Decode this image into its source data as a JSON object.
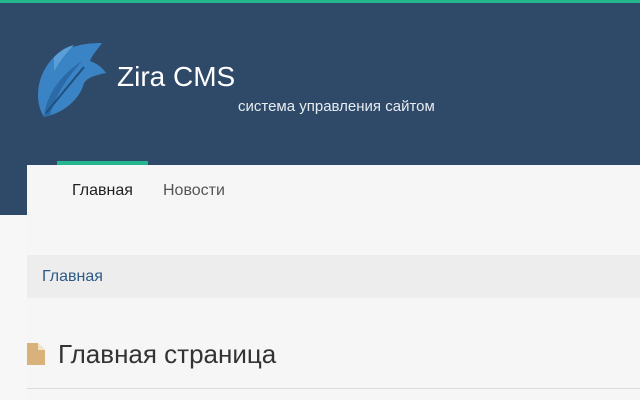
{
  "header": {
    "title": "Zira CMS",
    "subtitle": "система управления сайтом",
    "logo_icon": "leaf-logo-icon",
    "accent_color": "#26b68f",
    "background_color": "#2f4a68"
  },
  "nav": {
    "items": [
      {
        "label": "Главная",
        "active": true
      },
      {
        "label": "Новости",
        "active": false
      }
    ]
  },
  "breadcrumb": {
    "items": [
      "Главная"
    ]
  },
  "main": {
    "title": "Главная страница",
    "title_icon": "document-icon"
  }
}
